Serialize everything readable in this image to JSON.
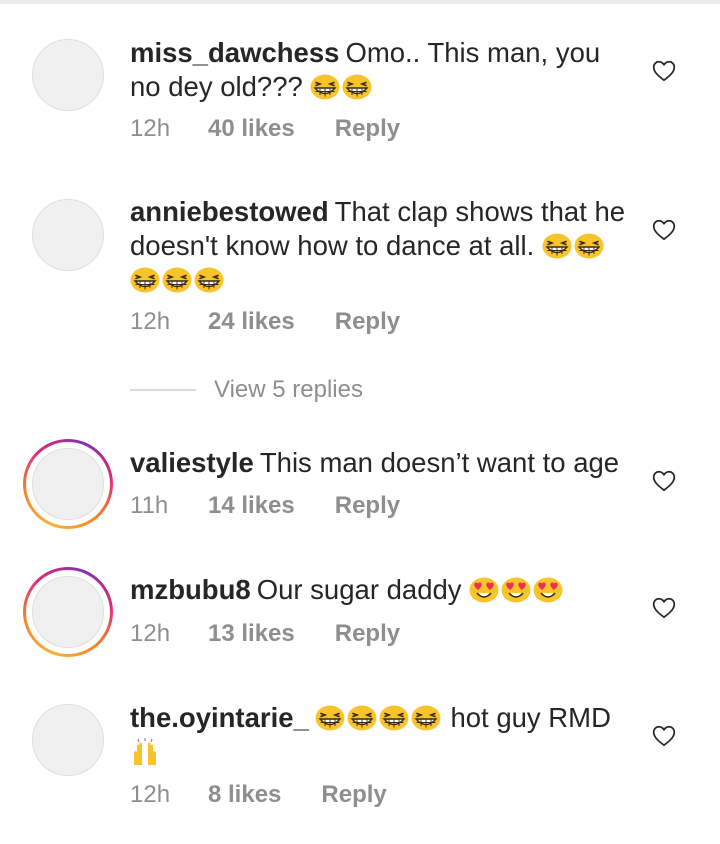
{
  "colors": {
    "text": "#262626",
    "meta": "#8e8e8e",
    "emoji": "#f9c32b",
    "divider": "#dbdbdb"
  },
  "comments": [
    {
      "username": "miss_dawchess",
      "text_line1": "Omo.. This man, you",
      "text_line2": "no dey old???",
      "emojis_line2": [
        "grinning-face-with-squinting-eyes",
        "grinning-face-with-squinting-eyes"
      ],
      "time": "12h",
      "likes": "40 likes",
      "reply": "Reply",
      "story_ring": false
    },
    {
      "username": "anniebestowed",
      "text_line1": "That clap shows that he",
      "text_line2": "doesn't know how to dance at all.",
      "emojis_line2": [
        "grinning-face-with-squinting-eyes",
        "grinning-face-with-squinting-eyes"
      ],
      "emojis_line3": [
        "grinning-face-with-squinting-eyes",
        "grinning-face-with-squinting-eyes",
        "grinning-face-with-squinting-eyes"
      ],
      "time": "12h",
      "likes": "24 likes",
      "reply": "Reply",
      "story_ring": false
    },
    {
      "username": "valiestyle",
      "text_line1": "This man doesn’t want to age",
      "time": "11h",
      "likes": "14 likes",
      "reply": "Reply",
      "story_ring": true
    },
    {
      "username": "mzbubu8",
      "text_line1": "Our sugar daddy",
      "emojis_line1": [
        "smiling-face-with-heart-eyes",
        "smiling-face-with-heart-eyes",
        "smiling-face-with-heart-eyes"
      ],
      "time": "12h",
      "likes": "13 likes",
      "reply": "Reply",
      "story_ring": true
    },
    {
      "username": "the.oyintarie_",
      "emojis_line1": [
        "grinning-face-with-squinting-eyes",
        "grinning-face-with-squinting-eyes",
        "grinning-face-with-squinting-eyes",
        "grinning-face-with-squinting-eyes"
      ],
      "text_line1_after": "hot guy RMD",
      "emojis_line2": [
        "raising-hands"
      ],
      "time": "12h",
      "likes": "8 likes",
      "reply": "Reply",
      "story_ring": false
    }
  ],
  "view_replies": "View 5 replies",
  "icons": {
    "like": "heart-outline-icon"
  }
}
